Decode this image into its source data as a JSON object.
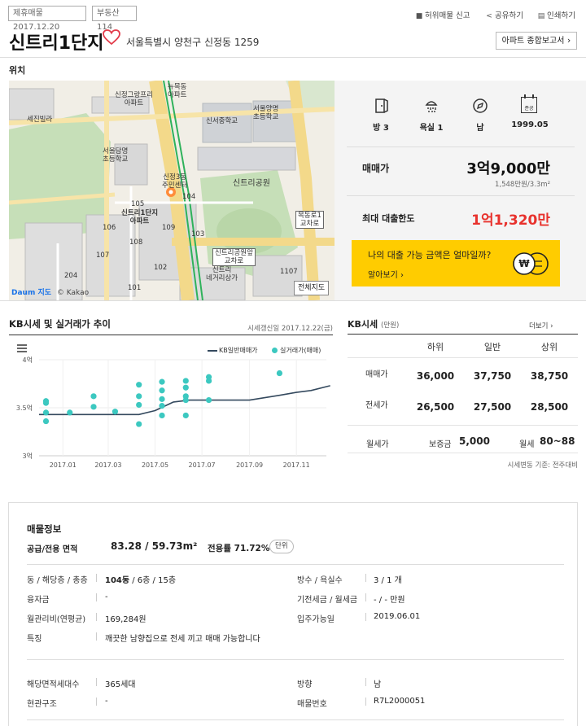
{
  "header": {
    "tag_date": "제휴매물 2017.12.20",
    "tag_source": "부동산114",
    "links": [
      {
        "label": "허위매물 신고",
        "icon": "person-icon"
      },
      {
        "label": "공유하기",
        "icon": "share-icon"
      },
      {
        "label": "인쇄하기",
        "icon": "print-icon"
      }
    ],
    "title": "신트리1단지",
    "address": "서울특별시 양천구 신정동 1259",
    "report_button": "아파트 종합보고서"
  },
  "location": {
    "heading": "위치",
    "full_map_button": "전체지도",
    "map_logo": "Daum 지도",
    "map_copyright": "© Kakao",
    "map_labels": {
      "newmok": "뉴목동\n아파트",
      "sinjeong_granry": "신정그랑프리\n아파트",
      "sinseo_middle": "신서중학교",
      "seoul_yangmyeong": "서울양명\n초등학교",
      "sejin": "세진빌라",
      "seoul_damyang": "서울담명\n초등학교",
      "community": "신정3동\n주민센터",
      "sintree1": "신트리1단지\n아파트",
      "sintree_park": "신트리공원",
      "sintree_cross": "신트리\n네거리상가",
      "mokdong_cross": "목동로1\n교차로",
      "sintree_park_cross": "신트리공원앞\n교차로",
      "dong_104": "104",
      "dong_105": "105",
      "dong_106": "106",
      "dong_109": "109",
      "dong_108": "108",
      "dong_103": "103",
      "dong_107": "107",
      "dong_102": "102",
      "dong_101": "101",
      "dong_204": "204",
      "dong_1107": "1107"
    }
  },
  "summary": {
    "icons": [
      {
        "icon": "door-icon",
        "label": "방 3"
      },
      {
        "icon": "shower-icon",
        "label": "욕실 1"
      },
      {
        "icon": "compass-icon",
        "label": "남"
      },
      {
        "icon": "calendar-icon",
        "label": "1999.05",
        "icon_text": "준공"
      }
    ],
    "sale_label": "매매가",
    "sale_price": "3억9,000만",
    "sale_unit_price": "1,548만원/3.3m²",
    "loan_label": "최대 대출한도",
    "loan_value": "1억1,320만",
    "banner_text": "나의 대출 가능 금액은 얼마일까?",
    "banner_link": "알아보기 ›"
  },
  "chart_section": {
    "title": "KB시세 및 실거래가 추이",
    "updated": "시세갱신일 2017.12.22(금)",
    "legend_kb": "KB일반매매가",
    "legend_real": "실거래가(매매)"
  },
  "chart_data": {
    "type": "line",
    "title": "KB시세 및 실거래가 추이",
    "ylim": [
      3.0,
      4.0
    ],
    "y_ticks": [
      "3억",
      "3.5억",
      "4억"
    ],
    "x_ticks": [
      "2017.01",
      "2017.03",
      "2017.05",
      "2017.07",
      "2017.09",
      "2017.11"
    ],
    "xlim": [
      "2016-12",
      "2017-12"
    ],
    "series": [
      {
        "name": "KB일반매매가",
        "kind": "line",
        "x": [
          "2016-12-01",
          "2017-04-10",
          "2017-05-01",
          "2017-05-25",
          "2017-06-15",
          "2017-09-01",
          "2017-10-10",
          "2017-11-01",
          "2017-11-20",
          "2017-12-15"
        ],
        "y": [
          3.43,
          3.43,
          3.47,
          3.56,
          3.58,
          3.58,
          3.63,
          3.66,
          3.68,
          3.73
        ]
      },
      {
        "name": "실거래가(매매)",
        "kind": "scatter",
        "x": [
          "2016-12-10",
          "2016-12-10",
          "2016-12-10",
          "2016-12-10",
          "2017-01-10",
          "2017-02-10",
          "2017-02-10",
          "2017-03-10",
          "2017-04-10",
          "2017-04-10",
          "2017-04-10",
          "2017-04-10",
          "2017-05-10",
          "2017-05-10",
          "2017-05-10",
          "2017-05-10",
          "2017-05-10",
          "2017-06-10",
          "2017-06-10",
          "2017-06-10",
          "2017-06-10",
          "2017-06-10",
          "2017-07-10",
          "2017-07-10",
          "2017-07-10",
          "2017-10-10"
        ],
        "y": [
          3.57,
          3.55,
          3.45,
          3.36,
          3.45,
          3.62,
          3.51,
          3.46,
          3.33,
          3.53,
          3.62,
          3.74,
          3.52,
          3.42,
          3.59,
          3.68,
          3.77,
          3.42,
          3.58,
          3.62,
          3.71,
          3.78,
          3.58,
          3.78,
          3.82,
          3.86
        ]
      }
    ]
  },
  "kb_price": {
    "title": "KB시세",
    "unit": "(만원)",
    "more": "더보기 ›",
    "columns": [
      "하위",
      "일반",
      "상위"
    ],
    "rows": [
      {
        "label": "매매가",
        "values": [
          "36,000",
          "37,750",
          "38,750"
        ]
      },
      {
        "label": "전세가",
        "values": [
          "26,500",
          "27,500",
          "28,500"
        ]
      }
    ],
    "monthly_label": "월세가",
    "deposit_label": "보증금",
    "deposit_value": "5,000",
    "rent_label": "월세",
    "rent_value": "80~88",
    "footnote": "시세변동 기준: 전주대비"
  },
  "property_info": {
    "title": "매물정보",
    "area_label": "공급/전용 면적",
    "area_value": "83.28 / 59.73m²",
    "ratio_label": "전용률 71.72%",
    "unit_button": "단위",
    "rows_left": [
      {
        "label": "동 / 해당층 / 총층",
        "value_bold": "104동",
        "value": " / 6층 / 15층"
      },
      {
        "label": "융자금",
        "value": "-"
      },
      {
        "label": "월관리비(연평균)",
        "value": "169,284원"
      },
      {
        "label": "특징",
        "value": "깨끗한 남향집으로 전세 끼고 매매 가능합니다"
      }
    ],
    "rows_right": [
      {
        "label": "방수 / 욕실수",
        "value": "3 / 1 개"
      },
      {
        "label": "기전세금 / 월세금",
        "value": "- / - 만원"
      },
      {
        "label": "입주가능일",
        "value": "2019.06.01"
      }
    ],
    "rows2_left": [
      {
        "label": "해당면적세대수",
        "value": "365세대"
      },
      {
        "label": "현관구조",
        "value": "-"
      }
    ],
    "rows2_right": [
      {
        "label": "방향",
        "value": "남"
      },
      {
        "label": "매물번호",
        "value": "R7L2000051"
      }
    ]
  },
  "colors": {
    "accent_yellow": "#ffcc00",
    "loan_red": "#e8322d",
    "kb_line": "#34495e",
    "dot_teal": "#3cc8c0"
  }
}
